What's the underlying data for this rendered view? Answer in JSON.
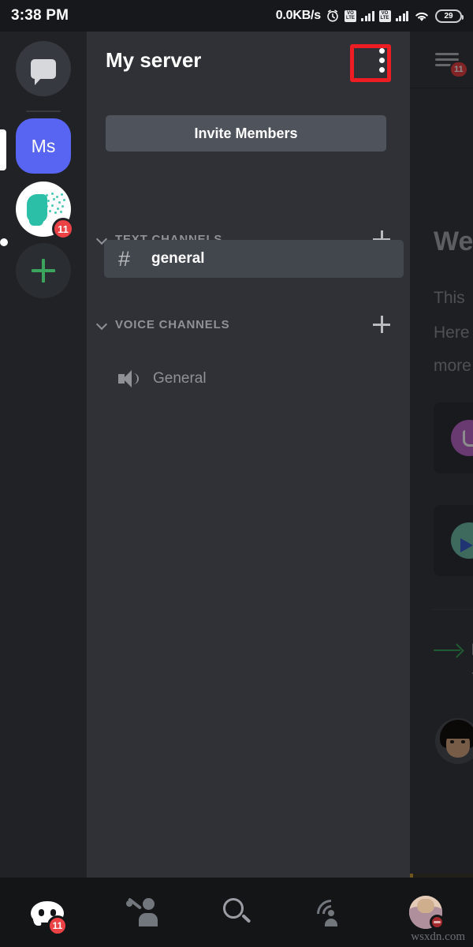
{
  "status_bar": {
    "time": "3:38 PM",
    "network_speed": "0.0KB/s",
    "alarm_icon": "alarm-clock-icon",
    "sim1_label_top": "VO",
    "sim1_label_bottom": "LTE",
    "sim2_label_top": "VO",
    "sim2_label_bottom": "LTE",
    "wifi_icon": "wifi-icon",
    "battery_level": "29"
  },
  "server_rail": {
    "home": {
      "name": "direct-messages",
      "icon": "chat-bubble-icon"
    },
    "servers": [
      {
        "initials": "Ms",
        "selected": true,
        "badge": ""
      },
      {
        "initials": "",
        "selected": false,
        "badge": "11",
        "icon": "head-profile-avatar"
      }
    ],
    "add_server": {
      "label": "+",
      "icon": "plus-icon"
    }
  },
  "drawer": {
    "server_title": "My server",
    "overflow_menu_icon": "three-dot-vertical-icon",
    "invite_button": "Invite Members",
    "sections": [
      {
        "label": "TEXT CHANNELS",
        "add_icon": "plus-icon",
        "collapse_icon": "chevron-down-icon",
        "channels": [
          {
            "name": "general",
            "prefix": "#",
            "active": true
          }
        ]
      },
      {
        "label": "VOICE CHANNELS",
        "add_icon": "plus-icon",
        "collapse_icon": "chevron-down-icon",
        "channels": [
          {
            "name": "General",
            "prefix": "speaker-icon",
            "active": false
          }
        ]
      }
    ]
  },
  "chat_panel": {
    "menu_icon": "hamburger-menu-icon",
    "menu_badge": "11",
    "welcome_title": "We",
    "line_1": "This",
    "line_2": "Here",
    "line_3": "more",
    "arrow_title": "F",
    "arrow_sub": "Y"
  },
  "bottom_nav": [
    {
      "name": "servers-tab",
      "icon": "discord-logo-icon",
      "badge": "11"
    },
    {
      "name": "friends-tab",
      "icon": "person-wave-icon",
      "badge": ""
    },
    {
      "name": "search-tab",
      "icon": "search-icon",
      "badge": ""
    },
    {
      "name": "mentions-tab",
      "icon": "mentions-broadcast-icon",
      "badge": ""
    },
    {
      "name": "profile-tab",
      "icon": "user-avatar",
      "badge": "",
      "status": "do-not-disturb"
    }
  ],
  "watermark": "wsxdn.com",
  "colors": {
    "accent_blurple": "#5865f2",
    "badge_red": "#ed4245",
    "highlight_red": "#ee1d24",
    "green": "#3ba55d",
    "drawer_bg": "#2f3136",
    "rail_bg": "#202225",
    "chat_bg": "#36393f"
  }
}
